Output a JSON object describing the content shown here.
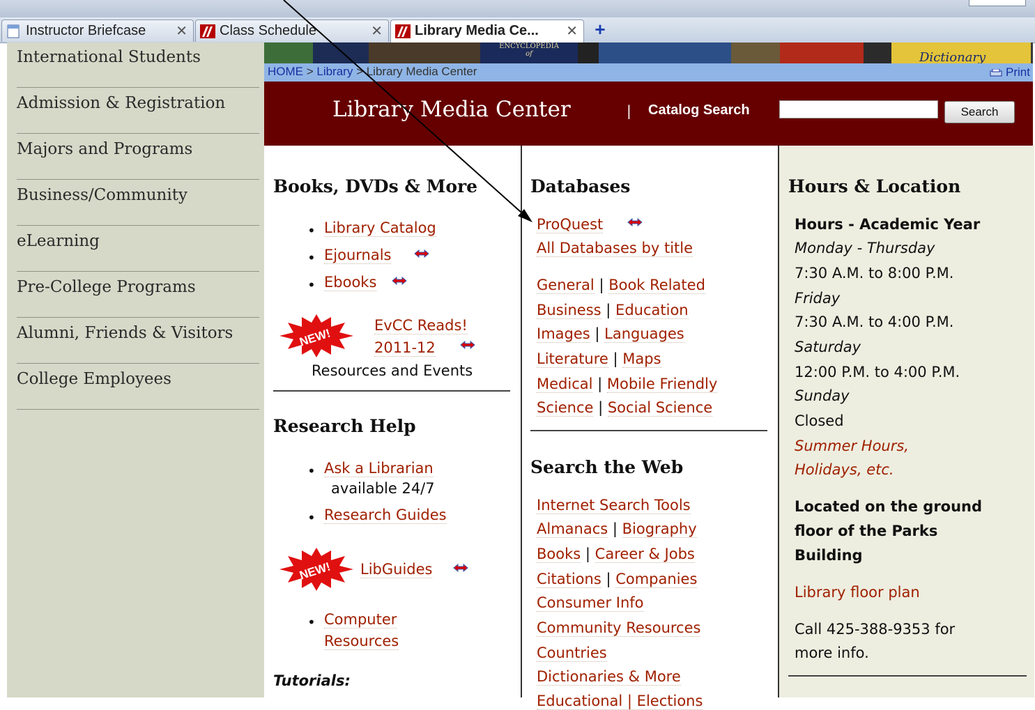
{
  "tabs": [
    {
      "label": "Instructor Briefcase",
      "close": "✕"
    },
    {
      "label": "Class Schedule",
      "close": "✕"
    },
    {
      "label": "Library Media Ce...",
      "close": "✕"
    }
  ],
  "newtab": "+",
  "leftnav": [
    "International Students",
    "Admission & Registration",
    "Majors and Programs",
    "Business/Community",
    "eLearning",
    "Pre-College Programs",
    "Alumni, Friends & Visitors",
    "College Employees"
  ],
  "banner": {
    "book_text": "Dictionary",
    "encyc": "ENCYCLOPEDIA",
    "of": "of"
  },
  "breadcrumb": {
    "home": "HOME",
    "sep": " > ",
    "library": "Library",
    "current": "Library Media Center",
    "print": "Print"
  },
  "header": {
    "title": "Library Media Center",
    "sep": "|",
    "catalog_label": "Catalog Search",
    "search_value": "",
    "search_button": "Search"
  },
  "books": {
    "heading": "Books, DVDs & More",
    "items": [
      "Library Catalog",
      "Ejournals",
      "Ebooks"
    ],
    "new_badge": "NEW!",
    "reads_line1": "EvCC Reads!",
    "reads_line2": "2011-12",
    "reads_sub": "Resources and Events"
  },
  "research": {
    "heading": "Research Help",
    "ask": "Ask a Librarian",
    "ask_sub": "available 24/7",
    "guides": "Research Guides",
    "libguides": "LibGuides",
    "computer1": "Computer",
    "computer2": "Resources",
    "tutorials": "Tutorials:"
  },
  "databases": {
    "heading": "Databases",
    "proquest": "ProQuest",
    "all": "All Databases by title",
    "pairs": [
      [
        "General",
        "Book Related"
      ],
      [
        "Business",
        "Education"
      ],
      [
        "Images",
        "Languages"
      ],
      [
        "Literature",
        "Maps"
      ],
      [
        "Medical",
        "Mobile Friendly"
      ],
      [
        "Science",
        "Social Science"
      ]
    ]
  },
  "web": {
    "heading": "Search the Web",
    "tools": "Internet Search Tools",
    "pairs": [
      [
        "Almanacs",
        "Biography"
      ],
      [
        "Books",
        "Career & Jobs"
      ],
      [
        "Citations",
        "Companies"
      ]
    ],
    "consumer": "Consumer Info",
    "community": "Community Resources",
    "countries": "Countries",
    "dictionaries": "Dictionaries & More",
    "cut": "Educational | Elections"
  },
  "hours": {
    "heading": "Hours & Location",
    "sub": "Hours - Academic Year",
    "mon": "Monday - Thursday",
    "mon_t": "7:30 A.M. to 8:00 P.M.",
    "fri": "Friday",
    "fri_t": "7:30 A.M. to 4:00 P.M.",
    "sat": "Saturday",
    "sat_t": "12:00 P.M. to 4:00 P.M.",
    "sun": "Sunday",
    "sun_t": "Closed",
    "summer1": "Summer Hours,",
    "summer2": "Holidays, etc.",
    "loc1": "Located on the ground",
    "loc2": "floor of the Parks",
    "loc3": "Building",
    "floorplan": "Library floor plan",
    "call1": "Call 425-388-9353 for",
    "call2": "more info."
  },
  "colors": {
    "header_bg": "#660000",
    "link": "#a02000",
    "leftnav_bg": "#d6d9c8",
    "breadcrumb_bg": "#8fb5e6",
    "hours_bg": "#edeee0"
  }
}
